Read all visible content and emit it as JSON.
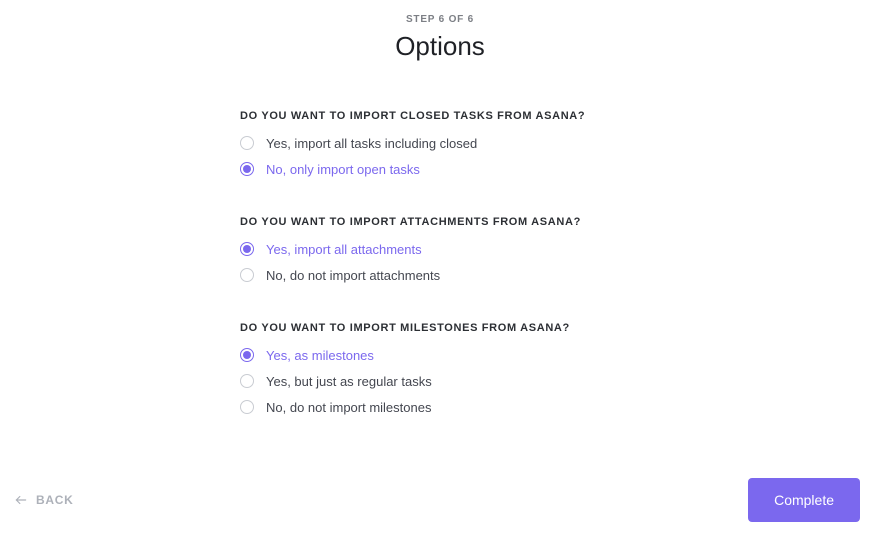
{
  "header": {
    "step_indicator": "STEP 6 OF 6",
    "title": "Options"
  },
  "groups": [
    {
      "question": "DO YOU WANT TO IMPORT CLOSED TASKS FROM ASANA?",
      "options": [
        {
          "label": "Yes, import all tasks including closed",
          "selected": false
        },
        {
          "label": "No, only import open tasks",
          "selected": true
        }
      ]
    },
    {
      "question": "DO YOU WANT TO IMPORT ATTACHMENTS FROM ASANA?",
      "options": [
        {
          "label": "Yes, import all attachments",
          "selected": true
        },
        {
          "label": "No, do not import attachments",
          "selected": false
        }
      ]
    },
    {
      "question": "DO YOU WANT TO IMPORT MILESTONES FROM ASANA?",
      "options": [
        {
          "label": "Yes, as milestones",
          "selected": true
        },
        {
          "label": "Yes, but just as regular tasks",
          "selected": false
        },
        {
          "label": "No, do not import milestones",
          "selected": false
        }
      ]
    }
  ],
  "footer": {
    "back_label": "BACK",
    "complete_label": "Complete"
  },
  "colors": {
    "accent": "#7b68ee"
  }
}
